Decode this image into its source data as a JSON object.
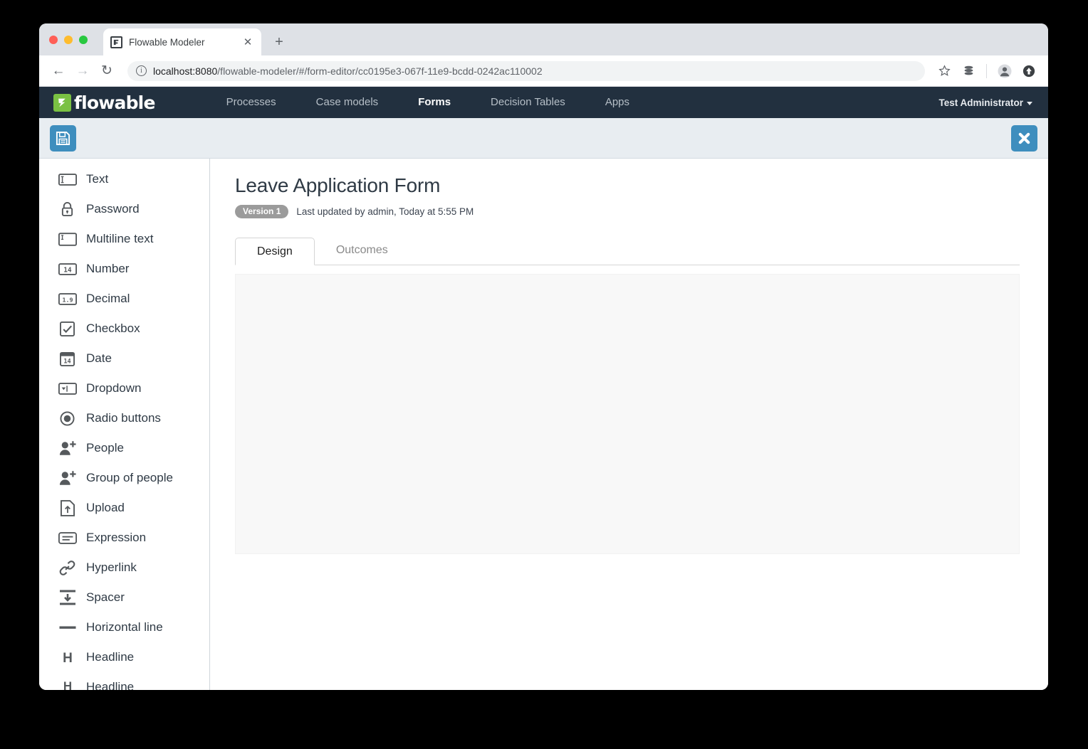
{
  "browser": {
    "tab_title": "Flowable Modeler",
    "favicon_name": "flowable-favicon",
    "close_tab_label": "✕",
    "new_tab_label": "+",
    "back_label": "←",
    "forward_label": "→",
    "reload_label": "↻",
    "info_label": "i",
    "url_host": "localhost:8080",
    "url_path": "/flowable-modeler/#/form-editor/cc0195e3-067f-11e9-bcdd-0242ac110002",
    "icons": [
      "star-icon",
      "stack-icon",
      "profile-avatar-icon",
      "update-icon"
    ]
  },
  "navbar": {
    "logo_text": "flowable",
    "items": [
      {
        "label": "Processes",
        "active": false
      },
      {
        "label": "Case models",
        "active": false
      },
      {
        "label": "Forms",
        "active": true
      },
      {
        "label": "Decision Tables",
        "active": false
      },
      {
        "label": "Apps",
        "active": false
      }
    ],
    "user": "Test Administrator"
  },
  "actionbar": {
    "save_name": "save-button",
    "close_name": "close-editor-button"
  },
  "palette": {
    "items": [
      {
        "label": "Text",
        "icon": "text-field-icon"
      },
      {
        "label": "Password",
        "icon": "lock-icon"
      },
      {
        "label": "Multiline text",
        "icon": "textarea-icon"
      },
      {
        "label": "Number",
        "icon": "number-field-icon"
      },
      {
        "label": "Decimal",
        "icon": "decimal-field-icon"
      },
      {
        "label": "Checkbox",
        "icon": "checkbox-icon"
      },
      {
        "label": "Date",
        "icon": "calendar-icon"
      },
      {
        "label": "Dropdown",
        "icon": "dropdown-icon"
      },
      {
        "label": "Radio buttons",
        "icon": "radio-button-icon"
      },
      {
        "label": "People",
        "icon": "person-add-icon"
      },
      {
        "label": "Group of people",
        "icon": "group-add-icon"
      },
      {
        "label": "Upload",
        "icon": "upload-icon"
      },
      {
        "label": "Expression",
        "icon": "expression-icon"
      },
      {
        "label": "Hyperlink",
        "icon": "link-icon"
      },
      {
        "label": "Spacer",
        "icon": "spacer-icon"
      },
      {
        "label": "Horizontal line",
        "icon": "horizontal-line-icon"
      },
      {
        "label": "Headline",
        "icon": "headline-icon"
      },
      {
        "label": "Headline",
        "icon": "headline-underline-icon"
      }
    ]
  },
  "form": {
    "title": "Leave Application Form",
    "version_badge": "Version 1",
    "last_updated": "Last updated by admin, Today at 5:55 PM",
    "tabs": [
      {
        "label": "Design",
        "active": true
      },
      {
        "label": "Outcomes",
        "active": false
      }
    ]
  },
  "colors": {
    "navbar_bg": "#22303f",
    "accent_blue": "#3e8ebe",
    "logo_green": "#7ac143",
    "badge_grey": "#9b9b9b",
    "canvas_bg": "#f8f8f8",
    "actionbar_bg": "#e8edf1"
  }
}
